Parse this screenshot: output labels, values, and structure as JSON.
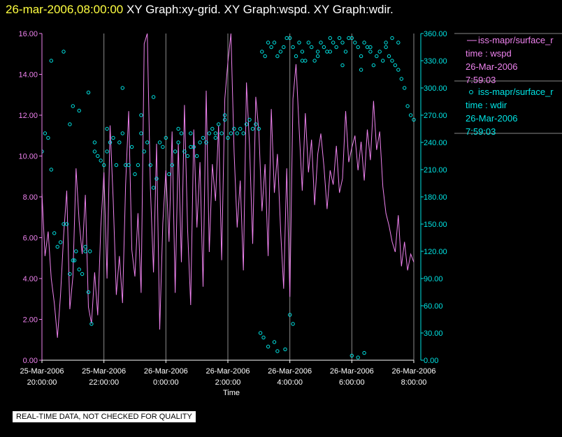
{
  "header": {
    "timestamp": "26-mar-2006,08:00:00",
    "subtitle": "XY Graph:xy-grid.  XY Graph:wspd.  XY Graph:wdir."
  },
  "quality_note": "REAL-TIME DATA, NOT CHECKED FOR QUALITY",
  "colors": {
    "background": "#000000",
    "wspd": "#ee82ee",
    "wdir": "#00e5e5",
    "grid": "#ffffff",
    "timestamp": "#ffff40"
  },
  "chart_data": {
    "type": "line",
    "xlabel": "Time",
    "x_ticks": [
      {
        "line1": "25-Mar-2006",
        "line2": "20:00:00",
        "hour": 20
      },
      {
        "line1": "25-Mar-2006",
        "line2": "22:00:00",
        "hour": 22
      },
      {
        "line1": "26-Mar-2006",
        "line2": "0:00:00",
        "hour": 24
      },
      {
        "line1": "26-Mar-2006",
        "line2": "2:00:00",
        "hour": 26
      },
      {
        "line1": "26-Mar-2006",
        "line2": "4:00:00",
        "hour": 28
      },
      {
        "line1": "26-Mar-2006",
        "line2": "6:00:00",
        "hour": 30
      },
      {
        "line1": "26-Mar-2006",
        "line2": "8:00:00",
        "hour": 32
      }
    ],
    "x_range_hours": [
      20,
      32
    ],
    "y_left": {
      "range": [
        0,
        16
      ],
      "ticks": [
        "0.00",
        "2.00",
        "4.00",
        "6.00",
        "8.00",
        "10.00",
        "12.00",
        "14.00",
        "16.00"
      ]
    },
    "y_right": {
      "range": [
        0,
        360
      ],
      "ticks": [
        "0.00",
        "30.00",
        "60.00",
        "90.00",
        "120.00",
        "150.00",
        "180.00",
        "210.00",
        "240.00",
        "270.00",
        "300.00",
        "330.00",
        "360.00"
      ]
    },
    "grid": true,
    "legend": {
      "position": "right",
      "entries": [
        {
          "marker": "line",
          "name": "iss-mapr/surface_r",
          "variable": "time : wspd",
          "date": "26-Mar-2006",
          "time": "7:59:03"
        },
        {
          "marker": "circle",
          "name": "iss-mapr/surface_r",
          "variable": "time : wdir",
          "date": "26-Mar-2006",
          "time": "7:59:03"
        }
      ]
    },
    "series": [
      {
        "style": "line",
        "color": "#ee82ee",
        "axis": "left",
        "x": [
          20.0,
          20.1,
          20.2,
          20.3,
          20.4,
          20.5,
          20.6,
          20.7,
          20.8,
          20.9,
          21.0,
          21.1,
          21.2,
          21.3,
          21.4,
          21.5,
          21.6,
          21.7,
          21.8,
          21.9,
          22.0,
          22.1,
          22.2,
          22.3,
          22.4,
          22.5,
          22.6,
          22.7,
          22.8,
          22.9,
          23.0,
          23.1,
          23.2,
          23.3,
          23.4,
          23.5,
          23.6,
          23.7,
          23.8,
          23.9,
          24.0,
          24.1,
          24.2,
          24.3,
          24.4,
          24.5,
          24.6,
          24.7,
          24.8,
          24.9,
          25.0,
          25.1,
          25.2,
          25.3,
          25.4,
          25.5,
          25.6,
          25.7,
          25.8,
          25.9,
          26.0,
          26.1,
          26.2,
          26.3,
          26.4,
          26.5,
          26.6,
          26.7,
          26.8,
          26.9,
          27.0,
          27.1,
          27.2,
          27.3,
          27.4,
          27.5,
          27.6,
          27.7,
          27.8,
          27.9,
          28.0,
          28.1,
          28.2,
          28.3,
          28.4,
          28.5,
          28.6,
          28.7,
          28.8,
          28.9,
          29.0,
          29.1,
          29.2,
          29.3,
          29.4,
          29.5,
          29.6,
          29.7,
          29.8,
          29.9,
          30.0,
          30.1,
          30.2,
          30.3,
          30.4,
          30.5,
          30.6,
          30.7,
          30.8,
          30.9,
          31.0,
          31.1,
          31.2,
          31.3,
          31.4,
          31.5,
          31.6,
          31.7,
          31.8,
          31.9,
          32.0
        ],
        "values": [
          8.2,
          5.1,
          6.3,
          4.0,
          2.8,
          1.1,
          3.2,
          6.1,
          8.3,
          2.5,
          4.1,
          9.4,
          6.8,
          5.2,
          8.1,
          2.6,
          1.8,
          4.3,
          2.2,
          6.5,
          9.2,
          4.0,
          11.5,
          7.8,
          3.2,
          5.1,
          2.8,
          8.6,
          12.2,
          5.4,
          4.1,
          7.2,
          3.3,
          15.5,
          16.0,
          8.4,
          4.3,
          10.6,
          1.5,
          6.7,
          9.3,
          5.8,
          11.2,
          3.3,
          10.6,
          4.8,
          12.5,
          6.4,
          2.7,
          11.3,
          6.5,
          9.7,
          3.6,
          13.2,
          5.3,
          9.6,
          7.8,
          11.5,
          4.9,
          12.8,
          14.6,
          16.0,
          10.2,
          6.5,
          8.8,
          4.4,
          13.6,
          10.5,
          5.7,
          12.9,
          11.2,
          7.3,
          9.6,
          5.1,
          12.3,
          8.2,
          10.1,
          6.4,
          3.5,
          9.4,
          3.1,
          12.8,
          14.5,
          11.3,
          8.3,
          12.1,
          9.2,
          10.8,
          7.6,
          10.1,
          11.1,
          9.5,
          7.4,
          9.3,
          8.6,
          10.5,
          8.2,
          8.9,
          12.2,
          9.7,
          10.4,
          11.0,
          9.3,
          10.7,
          8.8,
          11.3,
          9.8,
          12.7,
          10.3,
          11.2,
          8.5,
          7.2,
          6.6,
          5.8,
          5.3,
          7.1,
          4.6,
          5.8,
          4.4,
          5.2,
          4.8
        ]
      },
      {
        "style": "markers",
        "color": "#00e5e5",
        "axis": "right",
        "x": [
          20.0,
          20.1,
          20.2,
          20.3,
          20.4,
          20.5,
          20.6,
          20.7,
          20.8,
          20.9,
          21.0,
          21.1,
          21.2,
          21.3,
          21.4,
          21.5,
          21.6,
          21.7,
          21.8,
          21.9,
          22.0,
          22.1,
          22.2,
          22.3,
          22.4,
          22.5,
          22.6,
          22.7,
          22.8,
          22.9,
          23.0,
          23.1,
          23.2,
          23.3,
          23.4,
          23.5,
          23.6,
          23.7,
          23.8,
          23.9,
          24.0,
          24.1,
          24.2,
          24.3,
          24.4,
          24.5,
          24.6,
          24.7,
          24.8,
          24.9,
          25.0,
          25.1,
          25.2,
          25.3,
          25.4,
          25.5,
          25.6,
          25.7,
          25.8,
          25.9,
          26.0,
          26.1,
          26.2,
          26.3,
          26.4,
          26.5,
          26.6,
          26.7,
          26.8,
          26.9,
          27.0,
          27.1,
          27.2,
          27.3,
          27.4,
          27.5,
          27.6,
          27.7,
          27.8,
          27.9,
          28.0,
          28.1,
          28.2,
          28.3,
          28.4,
          28.5,
          28.6,
          28.7,
          28.8,
          28.9,
          29.0,
          29.1,
          29.2,
          29.3,
          29.4,
          29.5,
          29.6,
          29.7,
          29.8,
          29.9,
          30.0,
          30.1,
          30.2,
          30.3,
          30.4,
          30.5,
          30.6,
          30.7,
          30.8,
          30.9,
          31.0,
          31.1,
          31.2,
          31.3,
          31.4,
          31.5,
          31.6,
          31.7,
          31.8,
          31.9,
          32.0,
          20.3,
          20.7,
          20.9,
          21.0,
          21.2,
          21.5,
          21.7,
          22.1,
          22.6,
          23.2,
          23.6,
          24.4,
          24.8,
          25.6,
          25.9,
          27.05,
          27.15,
          27.3,
          27.5,
          27.6,
          27.85,
          28.0,
          28.1,
          30.0,
          30.2,
          30.4,
          28.4,
          28.9,
          29.3,
          29.7,
          30.3,
          30.6,
          31.1,
          31.3,
          31.5,
          21.05,
          21.4,
          21.55
        ],
        "values": [
          230,
          250,
          245,
          210,
          140,
          125,
          130,
          150,
          150,
          95,
          110,
          120,
          100,
          95,
          120,
          75,
          40,
          230,
          225,
          220,
          215,
          230,
          240,
          245,
          215,
          240,
          250,
          215,
          215,
          235,
          205,
          215,
          250,
          230,
          240,
          215,
          190,
          200,
          240,
          235,
          245,
          205,
          215,
          230,
          240,
          250,
          230,
          225,
          250,
          235,
          225,
          240,
          245,
          240,
          250,
          255,
          250,
          260,
          250,
          270,
          245,
          250,
          255,
          250,
          255,
          250,
          260,
          265,
          255,
          260,
          255,
          340,
          335,
          350,
          345,
          350,
          335,
          340,
          345,
          355,
          355,
          345,
          335,
          350,
          340,
          330,
          350,
          345,
          330,
          340,
          350,
          345,
          340,
          355,
          350,
          345,
          355,
          350,
          340,
          355,
          355,
          350,
          345,
          335,
          350,
          345,
          340,
          325,
          335,
          340,
          330,
          345,
          335,
          330,
          325,
          320,
          310,
          300,
          280,
          270,
          265,
          330,
          340,
          260,
          280,
          275,
          295,
          240,
          255,
          300,
          270,
          290,
          255,
          235,
          245,
          265,
          30,
          25,
          15,
          20,
          10,
          12,
          50,
          40,
          5,
          3,
          8,
          330,
          335,
          340,
          325,
          320,
          345,
          350,
          355,
          350,
          110,
          125,
          120
        ]
      }
    ]
  }
}
